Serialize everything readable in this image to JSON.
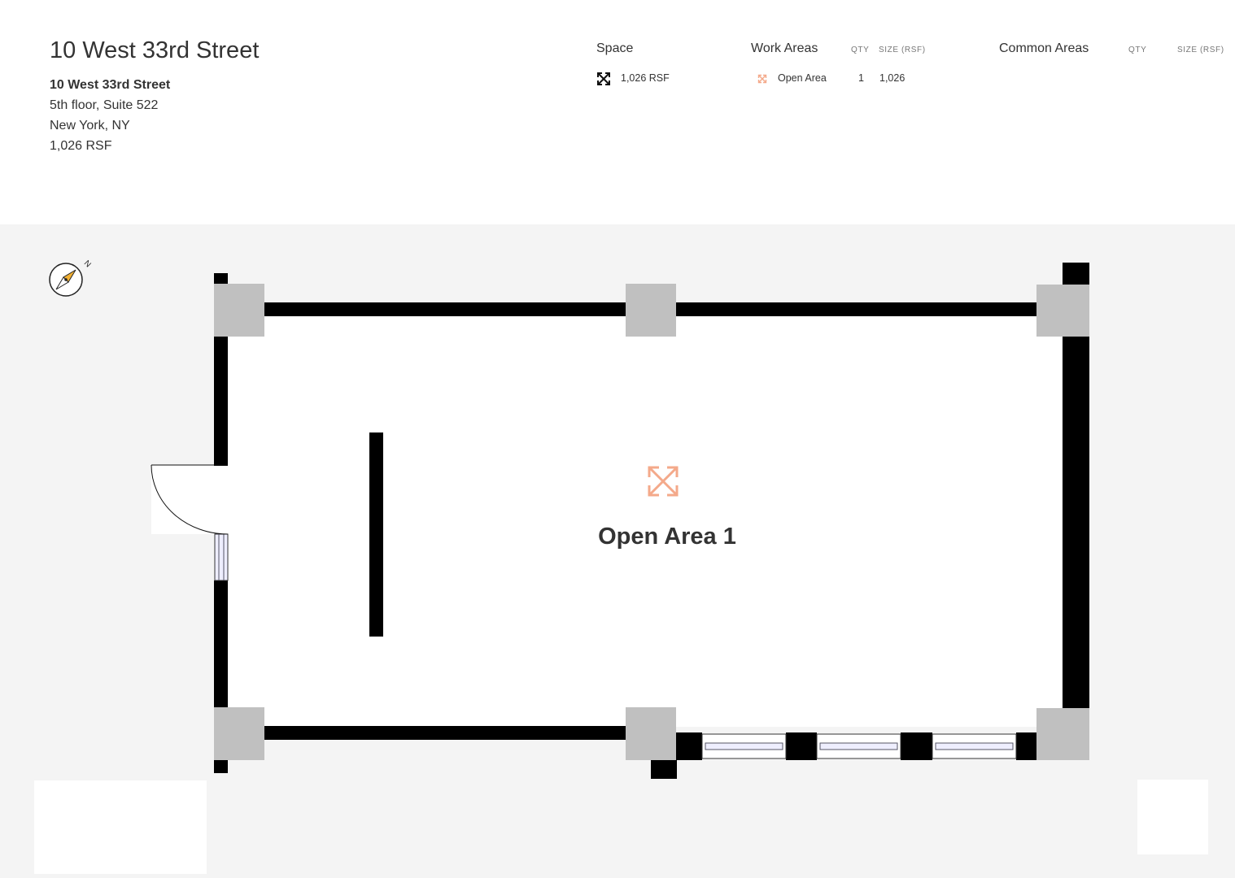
{
  "header": {
    "title": "10 West 33rd Street",
    "address_name": "10 West 33rd Street",
    "address_line1": "5th floor, Suite 522",
    "address_line2": "New York, NY",
    "size": "1,026 RSF"
  },
  "space": {
    "heading": "Space",
    "icon": "expand-arrows-icon",
    "value": "1,026 RSF"
  },
  "work_areas": {
    "heading": "Work Areas",
    "qty_header": "QTY",
    "size_header": "SIZE (RSF)",
    "rows": [
      {
        "icon": "expand-arrows-icon",
        "name": "Open Area",
        "qty": "1",
        "size": "1,026"
      }
    ]
  },
  "common_areas": {
    "heading": "Common Areas",
    "qty_header": "QTY",
    "size_header": "SIZE (RSF)",
    "rows": []
  },
  "floorplan": {
    "room_label": "Open Area 1",
    "room_icon": "expand-arrows-icon",
    "compass_label": "N",
    "colors": {
      "wall": "#000000",
      "column": "#c0c0c0",
      "room_fill": "#ffffff",
      "background": "#f4f4f4",
      "accent": "#f4a98a",
      "compass_needle": "#f2b134"
    }
  }
}
